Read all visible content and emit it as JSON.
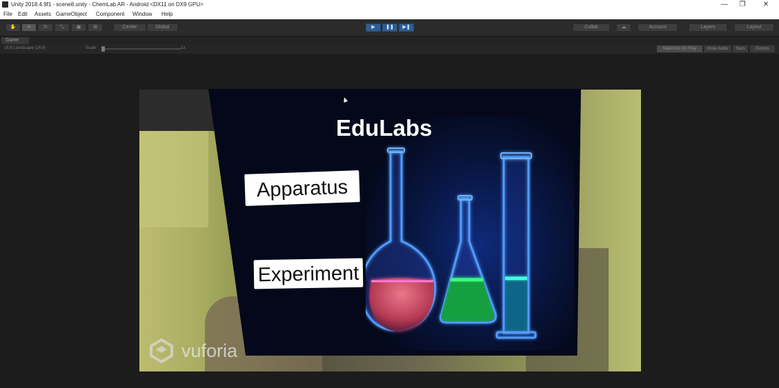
{
  "window": {
    "title": "Unity 2018.4.9f1 - scene8.unity - ChemLab AR - Android <DX11 on DX9 GPU>",
    "minimize": "—",
    "maximize": "❐",
    "close": "✕"
  },
  "menu": [
    "File",
    "Edit",
    "Assets",
    "GameObject",
    "Component",
    "Window",
    "Help"
  ],
  "toolbar": {
    "center_label": "Center",
    "global_label": "Global",
    "collab_label": "Collab",
    "account_label": "Account",
    "layers_label": "Layers",
    "layout_label": "Layout"
  },
  "game_view": {
    "tab_label": "Game",
    "aspect_label": "16:9 Landscape (16:9)",
    "scale_label": "Scale",
    "scale_value": "1x",
    "maximize_label": "Maximize On Play",
    "mute_label": "Mute Audio",
    "stats_label": "Stats",
    "gizmos_label": "Gizmos"
  },
  "ar_scene": {
    "title": "EduLabs",
    "buttons": [
      "Apparatus",
      "Experiment"
    ],
    "watermark": "vuforia"
  },
  "colors": {
    "editor_bg": "#1f1f1f",
    "play_active": "#2f5d8f",
    "card_bg": "#04081a",
    "glass_blue": "#3a8cff",
    "liquid_pink": "#d44a6e",
    "liquid_green": "#22e05a",
    "liquid_cyan": "#28e0c8"
  }
}
